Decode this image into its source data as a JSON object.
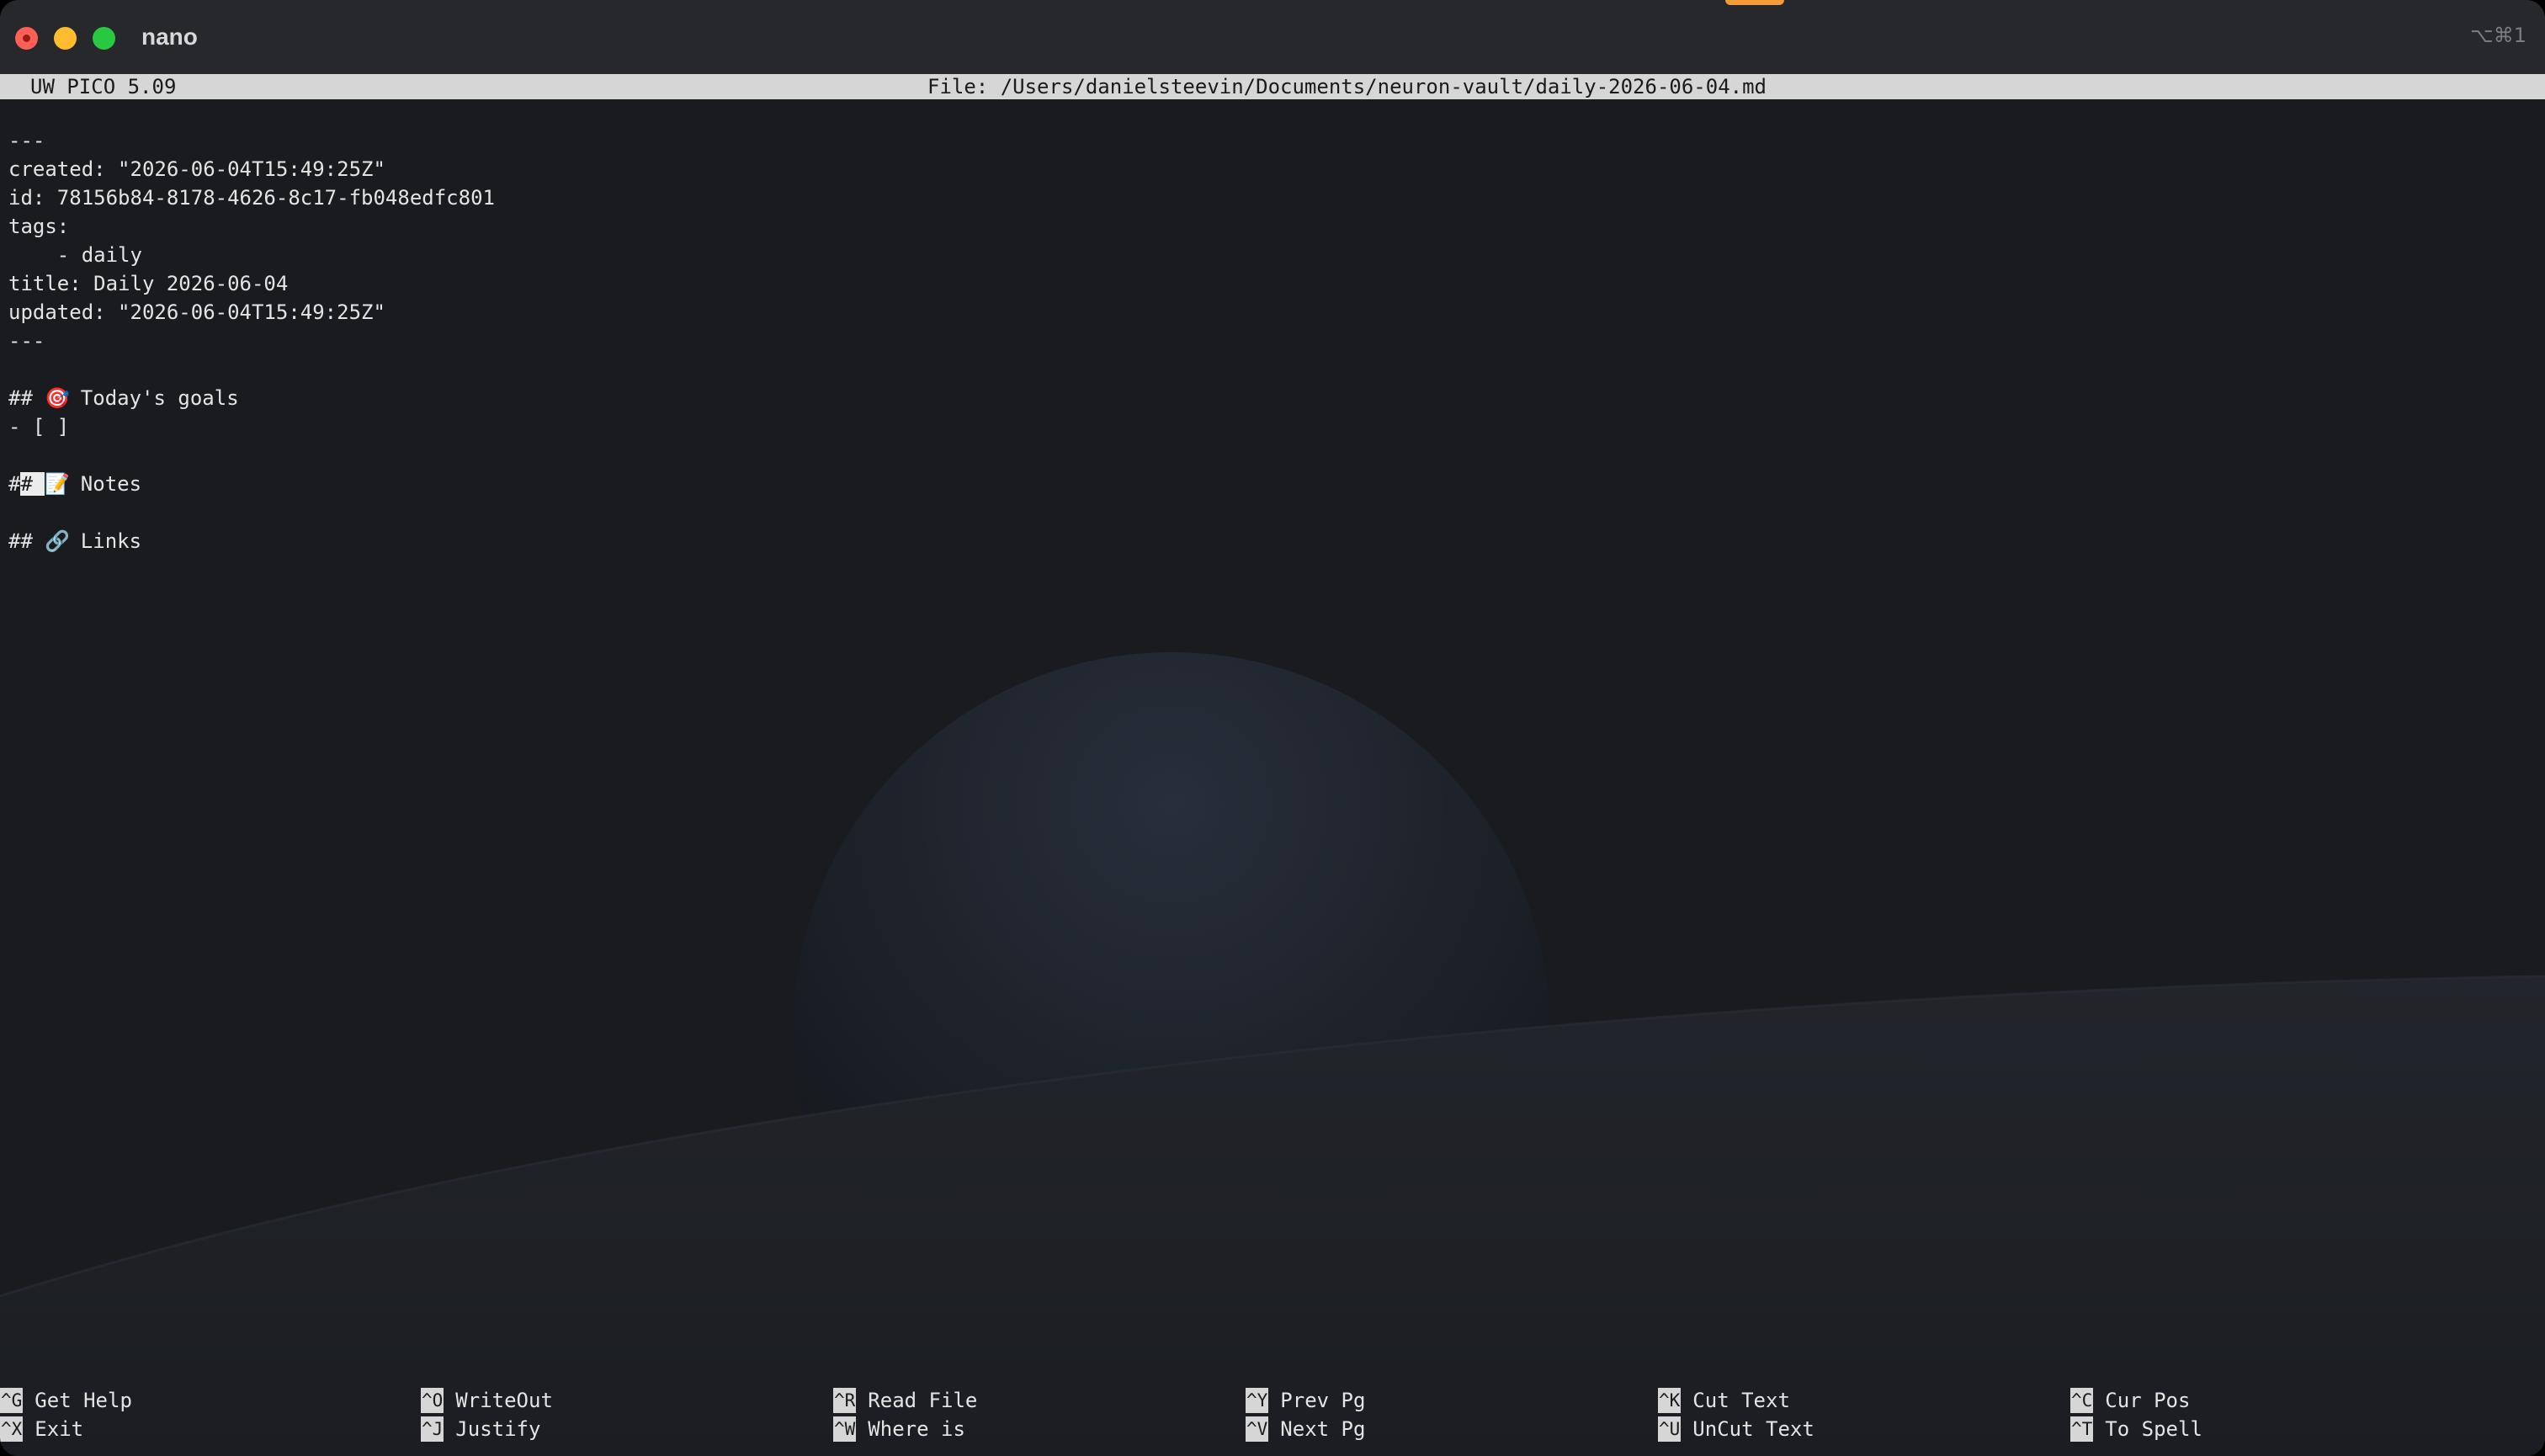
{
  "window": {
    "title": "nano",
    "shortcut_hint": "⌥⌘1"
  },
  "header": {
    "version": "UW PICO 5.09",
    "file": "File: /Users/danielsteevin/Documents/neuron-vault/daily-2026-06-04.md"
  },
  "document": {
    "frontmatter_open": "---",
    "created": "created: \"2026-06-04T15:49:25Z\"",
    "id": "id: 78156b84-8178-4626-8c17-fb048edfc801",
    "tags_key": "tags:",
    "tag_daily": "    - daily",
    "title": "title: Daily 2026-06-04",
    "updated": "updated: \"2026-06-04T15:49:25Z\"",
    "frontmatter_close": "---",
    "goals_prefix": "## ",
    "goals_emoji": "🎯",
    "goals_title": " Today's goals",
    "goals_item": "- [ ]",
    "notes_cursor_char": "#",
    "notes_prefix_rest": "# ",
    "notes_emoji": "📝",
    "notes_title": " Notes",
    "links_prefix": "## ",
    "links_emoji": "🔗",
    "links_title": " Links"
  },
  "shortcuts": [
    {
      "key": "^G",
      "label": "Get Help"
    },
    {
      "key": "^O",
      "label": "WriteOut"
    },
    {
      "key": "^R",
      "label": "Read File"
    },
    {
      "key": "^Y",
      "label": "Prev Pg"
    },
    {
      "key": "^K",
      "label": "Cut Text"
    },
    {
      "key": "^C",
      "label": "Cur Pos"
    },
    {
      "key": "^X",
      "label": "Exit"
    },
    {
      "key": "^J",
      "label": "Justify"
    },
    {
      "key": "^W",
      "label": "Where is"
    },
    {
      "key": "^V",
      "label": "Next Pg"
    },
    {
      "key": "^U",
      "label": "UnCut Text"
    },
    {
      "key": "^T",
      "label": "To Spell"
    }
  ]
}
